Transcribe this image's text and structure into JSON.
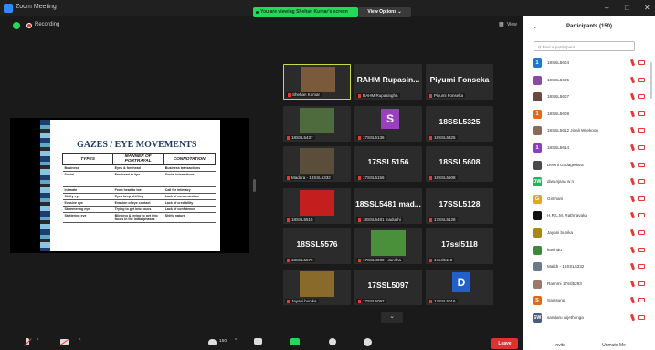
{
  "window": {
    "title": "Zoom Meeting",
    "viewing_banner": "You are viewing Shehan Kumar's screen",
    "view_options": "View Options ⌄",
    "recording_label": "Recording",
    "grid_view_label": "View"
  },
  "slide": {
    "title": "GAZES / EYE MOVEMENTS",
    "headers": [
      "TYPES",
      "MANNER OF PORTRAYAL",
      "CONNOTATION"
    ],
    "rows": [
      [
        "Business",
        "Eyes & forehead",
        "Business transactions"
      ],
      [
        "Social",
        "Forehead to lips",
        "Social interactions"
      ],
      [
        "Intimate",
        "From head to toe",
        "Call for intimacy"
      ],
      [
        "Shifty eye",
        "Eyes keep shifting",
        "Lack of concentration"
      ],
      [
        "Evasive eye",
        "Evasion of eye contact",
        "Lack of credibility"
      ],
      [
        "Stammering eye",
        "Trying to get into focus",
        "Lack of confidence"
      ],
      [
        "Stuttering eye",
        "Blinking & trying to get into focus in the initial phases",
        "Shifty nature"
      ]
    ]
  },
  "tiles": [
    {
      "name": "",
      "label": "Shehan Kumar",
      "photo": "#7a5a3a"
    },
    {
      "name": "RAHM  Rupasin...",
      "label": "RAHM Rupasingha"
    },
    {
      "name": "Piyumi Fonseka",
      "label": "Piyumi Fonseka"
    },
    {
      "name": "",
      "label": "18SSL5437",
      "photo": "#4e6b3e"
    },
    {
      "name": "",
      "label": "17SSL5136",
      "avatar": "S",
      "avatar_color": "#9b3fc1"
    },
    {
      "name": "18SSL5325",
      "label": "18SSL5325"
    },
    {
      "name": "",
      "label": "Madara - 18SSL5332",
      "photo": "#5a4e3a"
    },
    {
      "name": "17SSL5156",
      "label": "17SSL5156"
    },
    {
      "name": "18SSL5608",
      "label": "18SSL5608"
    },
    {
      "name": "",
      "label": "18SSL5515",
      "photo": "#c41e1e"
    },
    {
      "name": "18SSL5481  mad...",
      "label": "18SSL5481 madushi"
    },
    {
      "name": "17SSL5128",
      "label": "17SSL5128"
    },
    {
      "name": "18SSL5576",
      "label": "18SSL5576"
    },
    {
      "name": "",
      "label": "17SSL4980 - Janitha",
      "photo": "#4a8f3a"
    },
    {
      "name": "17ssl5118",
      "label": "17ssl5118"
    },
    {
      "name": "",
      "label": "Jayani bunika",
      "photo": "#8a6a2a"
    },
    {
      "name": "17SSL5097",
      "label": "17SSL5097"
    },
    {
      "name": "",
      "label": "17SSL5016",
      "avatar": "D",
      "avatar_color": "#2060c8"
    }
  ],
  "panel": {
    "title": "Participants (150)",
    "search_placeholder": "Find a participant",
    "participants": [
      {
        "name": "18SSL5604",
        "avatar": "1",
        "color": "#1f77d0"
      },
      {
        "name": "18SSL5605",
        "avatar": "",
        "color": "#8a4aa0"
      },
      {
        "name": "18SSL5607",
        "avatar": "",
        "color": "#6a4a3a"
      },
      {
        "name": "18SSL5608",
        "avatar": "1",
        "color": "#e06a1a"
      },
      {
        "name": "18SSL5612 Jinali Wijekoon",
        "avatar": "",
        "color": "#8a6a5a"
      },
      {
        "name": "18SSL5614",
        "avatar": "1",
        "color": "#8a3fc1"
      },
      {
        "name": "Dewni Godagedara",
        "avatar": "",
        "color": "#4a4a4a"
      },
      {
        "name": "diwanjana w n",
        "avatar": "DW",
        "color": "#23b35a"
      },
      {
        "name": "Gimhani",
        "avatar": "G",
        "color": "#e0a81a"
      },
      {
        "name": "H.R.L.M. Rathnayaka",
        "avatar": "",
        "color": "#111111"
      },
      {
        "name": "Jayani bunika",
        "avatar": "",
        "color": "#a8861a"
      },
      {
        "name": "kavindu",
        "avatar": "",
        "color": "#3a8a3a"
      },
      {
        "name": "Malith - 18SSL5332",
        "avatar": "",
        "color": "#6a7a8a"
      },
      {
        "name": "Rashmi 17ssl5293",
        "avatar": "",
        "color": "#9a7a6a"
      },
      {
        "name": "Samsung",
        "avatar": "S",
        "color": "#e06a1a"
      },
      {
        "name": "sandaru wijethunga",
        "avatar": "SW",
        "color": "#4a5a7a"
      }
    ],
    "invite_label": "Invite",
    "mute_all_label": "Unmute Me"
  },
  "toolbar": {
    "participants_count": "150",
    "leave_label": "Leave"
  }
}
